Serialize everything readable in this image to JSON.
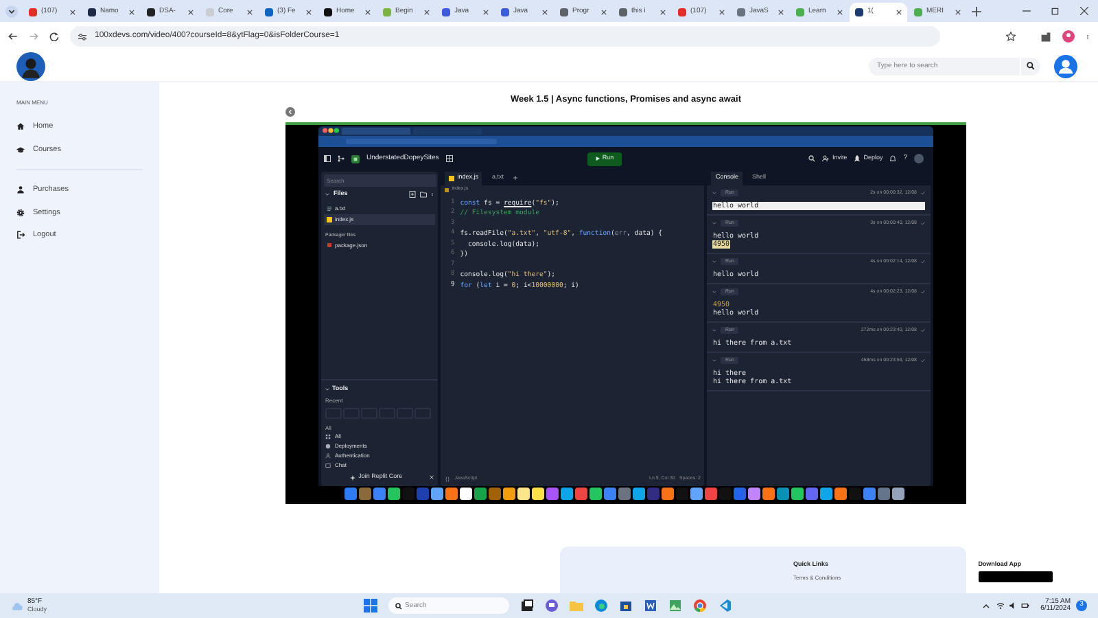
{
  "browser": {
    "tabs": [
      {
        "label": "(107)",
        "color": "#e52d27",
        "selected": false
      },
      {
        "label": "Namo",
        "color": "#1f2a44",
        "selected": false
      },
      {
        "label": "DSA-",
        "color": "#222222",
        "selected": false
      },
      {
        "label": "Core",
        "color": "#c9ccd1",
        "selected": false
      },
      {
        "label": "(3) Fe",
        "color": "#0a66c2",
        "selected": false
      },
      {
        "label": "Home",
        "color": "#111111",
        "selected": false
      },
      {
        "label": "Begin",
        "color": "#7cb342",
        "selected": false
      },
      {
        "label": "Java",
        "color": "#3b5bdb",
        "selected": false
      },
      {
        "label": "Java",
        "color": "#3b5bdb",
        "selected": false
      },
      {
        "label": "Progr",
        "color": "#5f6368",
        "selected": false
      },
      {
        "label": "this i",
        "color": "#5f6368",
        "selected": false
      },
      {
        "label": "(107)",
        "color": "#e52d27",
        "selected": false
      },
      {
        "label": "JavaS",
        "color": "#6b7280",
        "selected": false
      },
      {
        "label": "Learn",
        "color": "#4caf50",
        "selected": false
      },
      {
        "label": "1(",
        "color": "#1f3b73",
        "selected": true
      },
      {
        "label": "MERI",
        "color": "#4caf50",
        "selected": false
      }
    ],
    "address": "100xdevs.com/video/400?courseId=8&ytFlag=0&isFolderCourse=1"
  },
  "header": {
    "search": {
      "placeholder": "Type here to search"
    }
  },
  "sidebar": {
    "heading": "MAIN MENU",
    "sections": [
      {
        "items": [
          {
            "label": "Home"
          },
          {
            "label": "Courses"
          }
        ]
      },
      {
        "items": [
          {
            "label": "Purchases"
          },
          {
            "label": "Settings"
          },
          {
            "label": "Logout"
          }
        ]
      }
    ]
  },
  "video": {
    "title": "Week 1.5 | Async functions, Promises and async await",
    "ide": {
      "repl_name": "UnderstatedDopeySites",
      "run": "Run",
      "invite": "Invite",
      "deploy": "Deploy",
      "help": "?",
      "files_panel": {
        "search": {
          "placeholder": "Search"
        },
        "title": "Files",
        "files": [
          {
            "name": "a.txt",
            "kind": "text",
            "selected": false
          },
          {
            "name": "index.js",
            "kind": "js",
            "selected": true
          }
        ],
        "packager_title": "Packager files",
        "packager_files": [
          {
            "name": "package.json"
          }
        ]
      },
      "tools": {
        "title": "Tools",
        "recent": "Recent",
        "all_heading": "All",
        "items": [
          {
            "label": "All"
          },
          {
            "label": "Deployments"
          },
          {
            "label": "Authentication"
          },
          {
            "label": "Chat"
          }
        ]
      },
      "join": "Join Replit Core",
      "editor": {
        "tabs": [
          {
            "label": "index.js",
            "selected": true
          },
          {
            "label": "a.txt",
            "selected": false
          }
        ],
        "breadcrumb": "index.js",
        "lines": [
          {
            "number": "1",
            "active": false,
            "tokens": [
              {
                "text": "const",
                "kind": "keyword"
              },
              {
                "text": " fs = ",
                "kind": "plain"
              },
              {
                "text": "require",
                "kind": "call"
              },
              {
                "text": "(",
                "kind": "plain"
              },
              {
                "text": "\"fs\"",
                "kind": "string"
              },
              {
                "text": ");",
                "kind": "plain"
              }
            ]
          },
          {
            "number": "2",
            "active": false,
            "tokens": [
              {
                "text": "// Filesystem module",
                "kind": "comment"
              }
            ]
          },
          {
            "number": "3",
            "active": false
          },
          {
            "number": "4",
            "active": false,
            "tokens": [
              {
                "text": "fs.readFile(",
                "kind": "plain"
              },
              {
                "text": "\"a.txt\"",
                "kind": "string"
              },
              {
                "text": ", ",
                "kind": "plain"
              },
              {
                "text": "\"utf-8\"",
                "kind": "string"
              },
              {
                "text": ", ",
                "kind": "plain"
              },
              {
                "text": "function",
                "kind": "keyword"
              },
              {
                "text": "(",
                "kind": "plain"
              },
              {
                "text": "err",
                "kind": "param"
              },
              {
                "text": ", data) {",
                "kind": "plain"
              }
            ]
          },
          {
            "number": "5",
            "active": false,
            "tokens": [
              {
                "text": "  console.log(data);",
                "kind": "plain"
              }
            ]
          },
          {
            "number": "6",
            "active": false,
            "tokens": [
              {
                "text": "})",
                "kind": "plain"
              }
            ]
          },
          {
            "number": "7",
            "active": false
          },
          {
            "number": "8",
            "active": false,
            "tokens": [
              {
                "text": "console.log(",
                "kind": "plain"
              },
              {
                "text": "\"hi there\"",
                "kind": "string"
              },
              {
                "text": ");",
                "kind": "plain"
              }
            ]
          },
          {
            "number": "9",
            "active": true,
            "tokens": [
              {
                "text": "for",
                "kind": "keyword"
              },
              {
                "text": " (",
                "kind": "plain"
              },
              {
                "text": "let",
                "kind": "keyword"
              },
              {
                "text": " i = ",
                "kind": "plain"
              },
              {
                "text": "0",
                "kind": "number"
              },
              {
                "text": "; i<",
                "kind": "plain"
              },
              {
                "text": "10000000",
                "kind": "number"
              },
              {
                "text": "; i)",
                "kind": "plain"
              }
            ]
          }
        ],
        "language": "JavaScript",
        "position": "Ln 9, Col 30",
        "spaces": "Spaces: 2"
      },
      "console": {
        "tabs": [
          {
            "label": "Console",
            "selected": true
          },
          {
            "label": "Shell",
            "selected": false
          }
        ],
        "runs": [
          {
            "label": "Run",
            "time": "2s on 00:00:32, 12/08",
            "output": [
              {
                "text": "hello world",
                "kind": "selected"
              }
            ]
          },
          {
            "label": "Run",
            "time": "3s on 00:00:40, 12/08",
            "output": [
              {
                "text": "hello world",
                "kind": "plain"
              },
              {
                "text": "4950",
                "kind": "marked"
              }
            ]
          },
          {
            "label": "Run",
            "time": "4s on 00:02:14, 12/08",
            "output": [
              {
                "text": "hello world",
                "kind": "plain"
              }
            ]
          },
          {
            "label": "Run",
            "time": "4s on 00:02:23, 12/08",
            "output": [
              {
                "text": "4950",
                "kind": "number"
              },
              {
                "text": "hello world",
                "kind": "plain"
              }
            ]
          },
          {
            "label": "Run",
            "time": "272ms on 00:23:40, 12/08",
            "output": [
              {
                "text": "hi there from a.txt",
                "kind": "plain"
              }
            ]
          },
          {
            "label": "Run",
            "time": "458ms on 00:23:59, 12/08",
            "output": [
              {
                "text": "hi there",
                "kind": "plain"
              },
              {
                "text": "hi there from a.txt",
                "kind": "plain"
              }
            ]
          }
        ]
      }
    }
  },
  "footer_card": {
    "quick_links": "Quick Links",
    "link": "Terms & Conditions",
    "download": "Download App"
  },
  "taskbar": {
    "temperature": "85°F",
    "condition": "Cloudy",
    "search": {
      "placeholder": "Search"
    },
    "time": "7:15 AM",
    "date": "6/11/2024",
    "notifications": "3"
  }
}
